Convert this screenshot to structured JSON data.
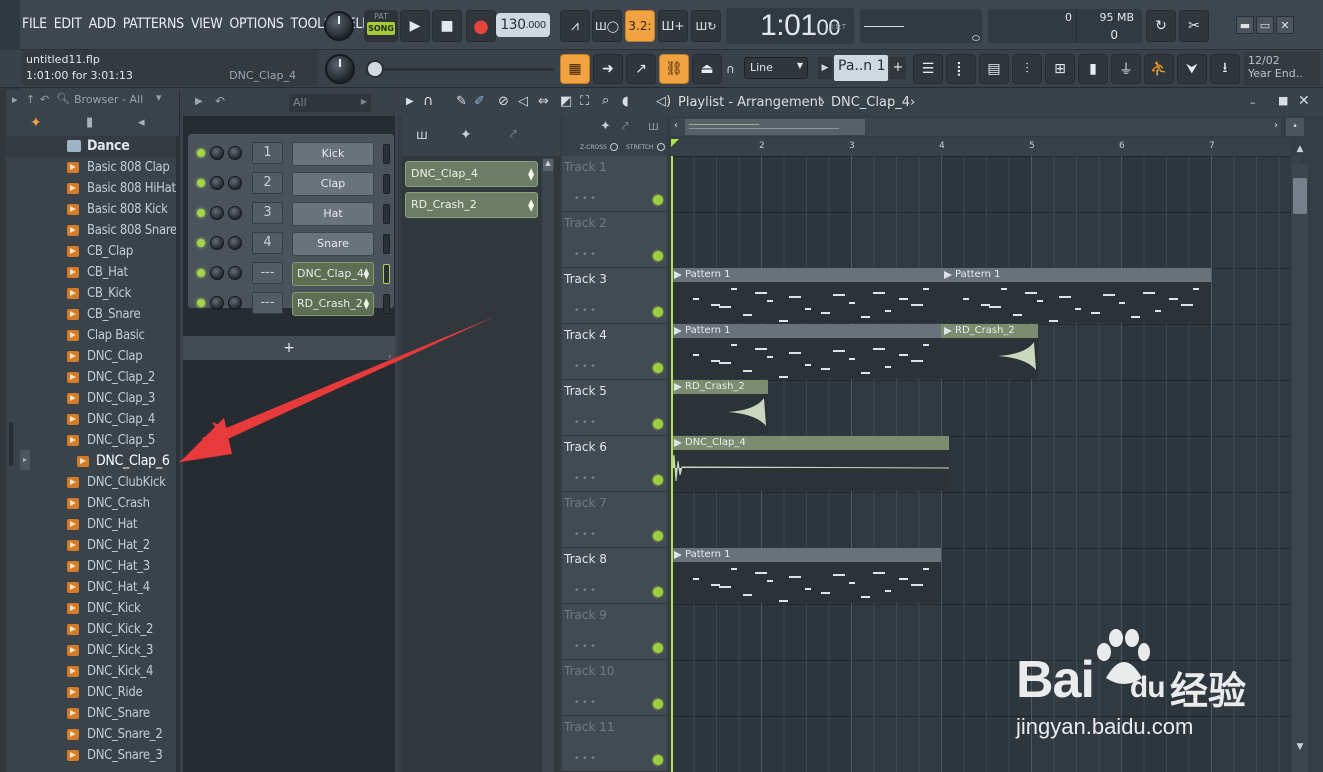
{
  "menu": [
    "FILE",
    "EDIT",
    "ADD",
    "PATTERNS",
    "VIEW",
    "OPTIONS",
    "TOOLS",
    "HELP"
  ],
  "transport": {
    "pat_label": "PAT",
    "song_label": "SONG",
    "tempo_main": "130",
    "tempo_fraction": ".000"
  },
  "time_display": {
    "main": "1:01",
    "sub": "00",
    "bst_label": "B:S:T"
  },
  "cpu": {
    "value1": "0",
    "memory": "95 MB",
    "value2": "0"
  },
  "snap_label": "3.2:",
  "hint": {
    "file": "untitled11.flp",
    "position": "1:01:00 for 3:01:13",
    "channel": "DNC_Clap_4"
  },
  "line_mode": "Line",
  "pattern_selector": "Pa..n 1",
  "news": {
    "date": "12/02",
    "text": "Year End.."
  },
  "browser": {
    "title": "Browser - All",
    "folder": "Dance",
    "items": [
      "Basic 808 Clap",
      "Basic 808 HiHat",
      "Basic 808 Kick",
      "Basic 808 Snare",
      "CB_Clap",
      "CB_Hat",
      "CB_Kick",
      "CB_Snare",
      "Clap Basic",
      "DNC_Clap",
      "DNC_Clap_2",
      "DNC_Clap_3",
      "DNC_Clap_4",
      "DNC_Clap_5"
    ],
    "selected": "DNC_Clap_6",
    "items_after": [
      "DNC_ClubKick",
      "DNC_Crash",
      "DNC_Hat",
      "DNC_Hat_2",
      "DNC_Hat_3",
      "DNC_Hat_4",
      "DNC_Kick",
      "DNC_Kick_2",
      "DNC_Kick_3",
      "DNC_Kick_4",
      "DNC_Ride",
      "DNC_Snare",
      "DNC_Snare_2",
      "DNC_Snare_3"
    ]
  },
  "rack": {
    "filter": "All",
    "add_label": "+",
    "channels": [
      {
        "num": "1",
        "name": "Kick"
      },
      {
        "num": "2",
        "name": "Clap"
      },
      {
        "num": "3",
        "name": "Hat"
      },
      {
        "num": "4",
        "name": "Snare"
      },
      {
        "num": "---",
        "name": "DNC_Clap_4"
      },
      {
        "num": "---",
        "name": "RD_Crash_2"
      }
    ]
  },
  "playlist": {
    "title": "Playlist - Arrangement",
    "crumb": "DNC_Clap_4",
    "zcross": "Z-CROSS",
    "stretch": "STRETCH",
    "picker": [
      "DNC_Clap_4",
      "RD_Crash_2"
    ],
    "ruler": [
      "2",
      "3",
      "4",
      "5",
      "6",
      "7"
    ],
    "tracks": [
      "Track 1",
      "Track 2",
      "Track 3",
      "Track 4",
      "Track 5",
      "Track 6",
      "Track 7",
      "Track 8",
      "Track 9",
      "Track 10",
      "Track 11"
    ],
    "clips": {
      "t3a": "Pattern 1",
      "t3b": "Pattern 1",
      "t4a": "Pattern 1",
      "t4b": "RD_Crash_2",
      "t5": "RD_Crash_2",
      "t6": "DNC_Clap_4",
      "t8": "Pattern 1"
    }
  },
  "watermark": {
    "brand": "Bai",
    "brand2": "du",
    "cn": "经验",
    "url": "jingyan.baidu.com"
  }
}
